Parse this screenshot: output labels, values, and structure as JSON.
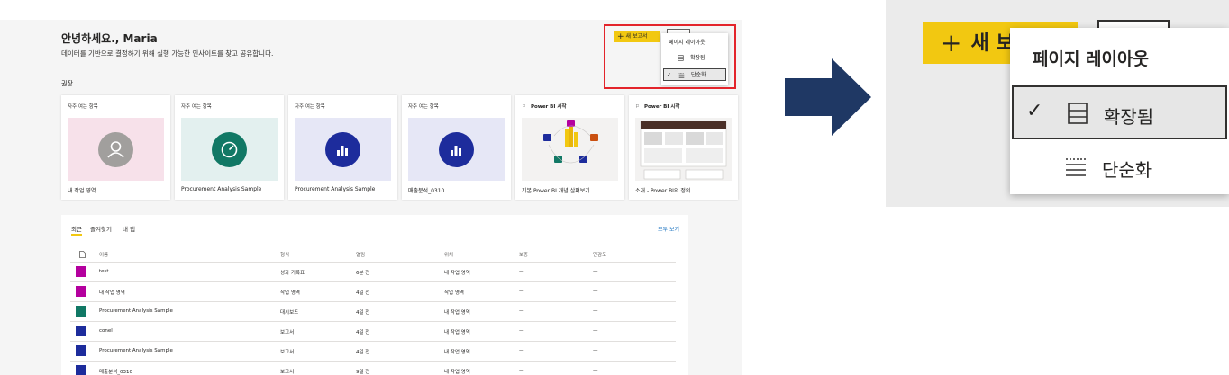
{
  "home": {
    "greeting": "안녕하세요., Maria",
    "subtitle": "데이터를 기반으로 결정하기 위해 실행 가능한 인사이트를 찾고 공유합니다.",
    "new_report_label": "새 보고서",
    "layout_menu": {
      "header": "페이지 레이아웃",
      "items": [
        {
          "label": "확장됨",
          "checked": false
        },
        {
          "label": "단순화",
          "checked": true
        }
      ]
    },
    "recommended_label": "권장",
    "cards": [
      {
        "tag": "자주 여는 항목",
        "name": "내 작업 영역",
        "icon": "person-icon",
        "bg": "#f7e1ea",
        "circle": "#a19f9d"
      },
      {
        "tag": "자주 여는 항목",
        "name": "Procurement Analysis Sample",
        "icon": "gauge-icon",
        "bg": "#e3f0ef",
        "circle": "#117865"
      },
      {
        "tag": "자주 여는 항목",
        "name": "Procurement Analysis Sample",
        "icon": "bar-chart-icon",
        "bg": "#e6e7f6",
        "circle": "#1d2c9c"
      },
      {
        "tag": "자주 여는 항목",
        "name": "매출분석_0310",
        "icon": "bar-chart-icon",
        "bg": "#e6e7f6",
        "circle": "#1d2c9c"
      },
      {
        "tag": "Power BI 시작",
        "name": "기본 Power BI 개념 살펴보기",
        "icon": "flag-icon",
        "bg": "#f3f2f1"
      },
      {
        "tag": "Power BI 시작",
        "name": "소개 - Power BI의 정의",
        "icon": "flag-icon",
        "bg": "#f3f2f1"
      }
    ],
    "recent": {
      "tabs": [
        "최근",
        "즐겨찾기",
        "내 앱"
      ],
      "see_all": "모두 보기",
      "columns": [
        "이름",
        "형식",
        "열림",
        "위치",
        "보증",
        "민감도"
      ],
      "rows": [
        {
          "name": "test",
          "type": "성과 기록표",
          "opened": "6분 전",
          "location": "내 작업 영역",
          "endorsement": "—",
          "sensitivity": "—",
          "icon_color": "#b4009e"
        },
        {
          "name": "내 작업 영역",
          "type": "작업 영역",
          "opened": "4일 전",
          "location": "작업 영역",
          "endorsement": "—",
          "sensitivity": "—",
          "icon_color": "#b4009e"
        },
        {
          "name": "Procurement Analysis Sample",
          "type": "대시보드",
          "opened": "4일 전",
          "location": "내 작업 영역",
          "endorsement": "—",
          "sensitivity": "—",
          "icon_color": "#117865"
        },
        {
          "name": "conel",
          "type": "보고서",
          "opened": "4일 전",
          "location": "내 작업 영역",
          "endorsement": "—",
          "sensitivity": "—",
          "icon_color": "#1d2c9c"
        },
        {
          "name": "Procurement Analysis Sample",
          "type": "보고서",
          "opened": "4일 전",
          "location": "내 작업 영역",
          "endorsement": "—",
          "sensitivity": "—",
          "icon_color": "#1d2c9c"
        },
        {
          "name": "매출분석_0310",
          "type": "보고서",
          "opened": "9일 전",
          "location": "내 작업 영역",
          "endorsement": "—",
          "sensitivity": "—",
          "icon_color": "#1d2c9c"
        }
      ]
    }
  },
  "zoom": {
    "new_report_label": "새 보",
    "menu_header": "페이지 레이아웃",
    "items": [
      {
        "label": "확장됨",
        "checked": true
      },
      {
        "label": "단순화",
        "checked": false
      }
    ]
  },
  "colors": {
    "accent": "#f2c811",
    "highlight": "#e3242b",
    "arrow": "#1f3864"
  }
}
